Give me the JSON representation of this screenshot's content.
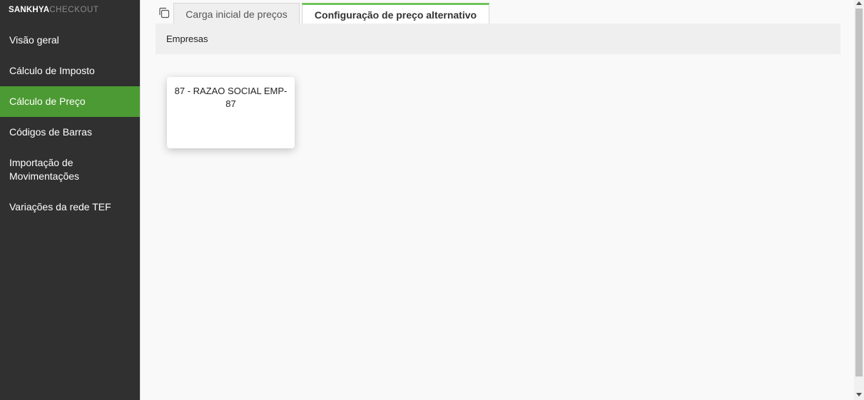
{
  "brand": {
    "strong": "SANKHYA",
    "light": "CHECKOUT"
  },
  "sidebar": {
    "items": [
      {
        "label": "Visão geral"
      },
      {
        "label": "Cálculo de Imposto"
      },
      {
        "label": "Cálculo de Preço",
        "active": true
      },
      {
        "label": "Códigos de Barras"
      },
      {
        "label": "Importação de Movimentações"
      },
      {
        "label": "Variações da rede TEF"
      }
    ]
  },
  "tabs": [
    {
      "label": "Carga inicial de preços"
    },
    {
      "label": "Configuração de preço alternativo",
      "active": true
    }
  ],
  "panel": {
    "title": "Empresas"
  },
  "companies": [
    {
      "label": "87 - RAZAO SOCIAL EMP-87"
    }
  ],
  "colors": {
    "sidebar_bg": "#2f302f",
    "active": "#4c9a33",
    "tab_accent": "#6fc45a"
  },
  "icons": {
    "copy": "copy-icon"
  }
}
